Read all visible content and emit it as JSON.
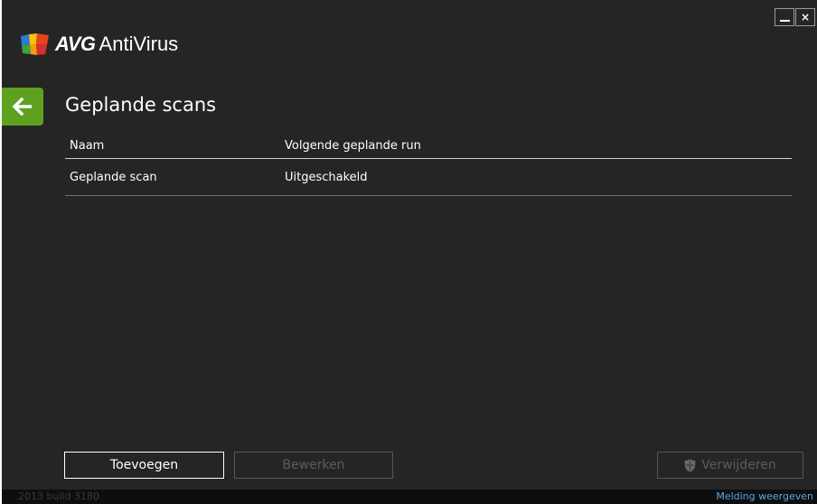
{
  "app": {
    "brand": "AVG",
    "product": "AntiVirus"
  },
  "window_controls": {
    "close_label": "×"
  },
  "page": {
    "title": "Geplande scans"
  },
  "table": {
    "headers": [
      "Naam",
      "Volgende geplande run"
    ],
    "rows": [
      [
        "Geplande scan",
        "Uitgeschakeld"
      ]
    ]
  },
  "buttons": {
    "add": "Toevoegen",
    "edit": "Bewerken",
    "delete": "Verwijderen"
  },
  "footer": {
    "version": "2013  build 3180",
    "notification_link": "Melding weergeven"
  },
  "colors": {
    "background": "#252525",
    "accent_green": "#5da11f",
    "link_blue": "#5aa9e6",
    "disabled_text": "#5c5c5c"
  }
}
